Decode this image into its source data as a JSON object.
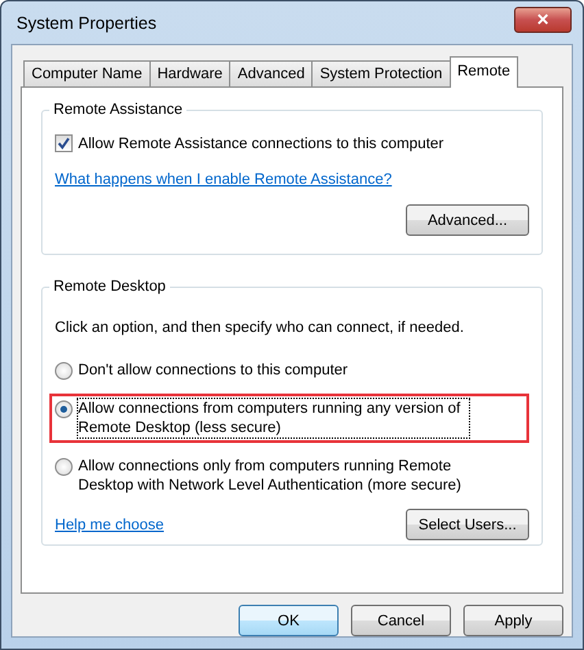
{
  "window": {
    "title": "System Properties",
    "close_button": "×"
  },
  "tabs": [
    {
      "label": "Computer Name",
      "selected": false
    },
    {
      "label": "Hardware",
      "selected": false
    },
    {
      "label": "Advanced",
      "selected": false
    },
    {
      "label": "System Protection",
      "selected": false
    },
    {
      "label": "Remote",
      "selected": true
    }
  ],
  "remote_assistance": {
    "title": "Remote Assistance",
    "checkbox": {
      "label": "Allow Remote Assistance connections to this computer",
      "checked": true
    },
    "link": "What happens when I enable Remote Assistance?",
    "button": "Advanced..."
  },
  "remote_desktop": {
    "title": "Remote Desktop",
    "instruction": "Click an option, and then specify who can connect, if needed.",
    "options": [
      {
        "label": "Don't allow connections to this computer",
        "selected": false,
        "highlighted": false
      },
      {
        "label": "Allow connections from computers running any version of Remote Desktop (less secure)",
        "selected": true,
        "highlighted": true
      },
      {
        "label": "Allow connections only from computers running Remote Desktop with Network Level Authentication (more secure)",
        "selected": false,
        "highlighted": false
      }
    ],
    "link": "Help me choose",
    "button": "Select Users..."
  },
  "buttons": [
    {
      "label": "OK",
      "default": true
    },
    {
      "label": "Cancel",
      "default": false
    },
    {
      "label": "Apply",
      "default": false
    }
  ]
}
